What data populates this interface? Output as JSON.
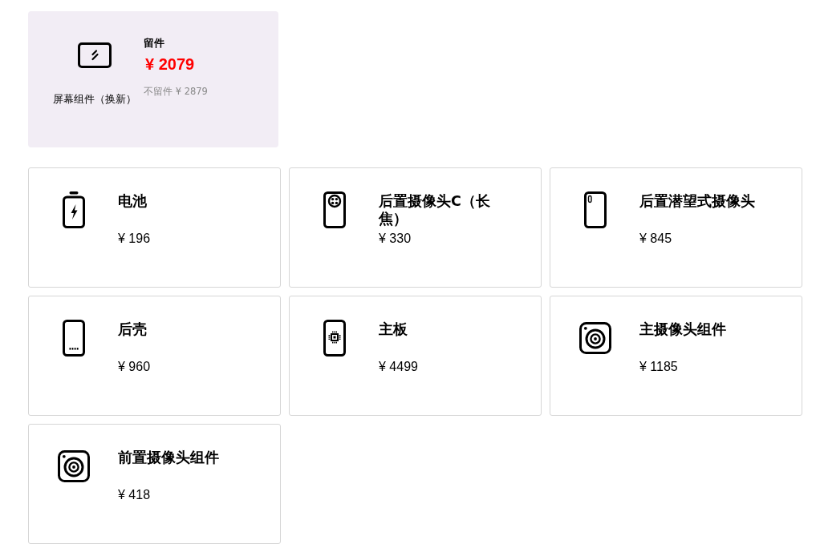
{
  "featured": {
    "name": "屏幕组件（换新）",
    "keep_label": "留件",
    "keep_price": "¥ 2079",
    "no_keep_price": "不留件 ¥ 2879"
  },
  "parts": [
    {
      "kind": "battery",
      "name": "电池",
      "price": "¥ 196"
    },
    {
      "kind": "rear-camera",
      "name": "后置摄像头C（长焦）",
      "price": "¥ 330"
    },
    {
      "kind": "periscope",
      "name": "后置潜望式摄像头",
      "price": "¥ 845"
    },
    {
      "kind": "back-cover",
      "name": "后壳",
      "price": "¥ 960"
    },
    {
      "kind": "mainboard",
      "name": "主板",
      "price": "¥ 4499"
    },
    {
      "kind": "camera",
      "name": "主摄像头组件",
      "price": "¥ 1185"
    },
    {
      "kind": "camera",
      "name": "前置摄像头组件",
      "price": "¥ 418"
    }
  ]
}
